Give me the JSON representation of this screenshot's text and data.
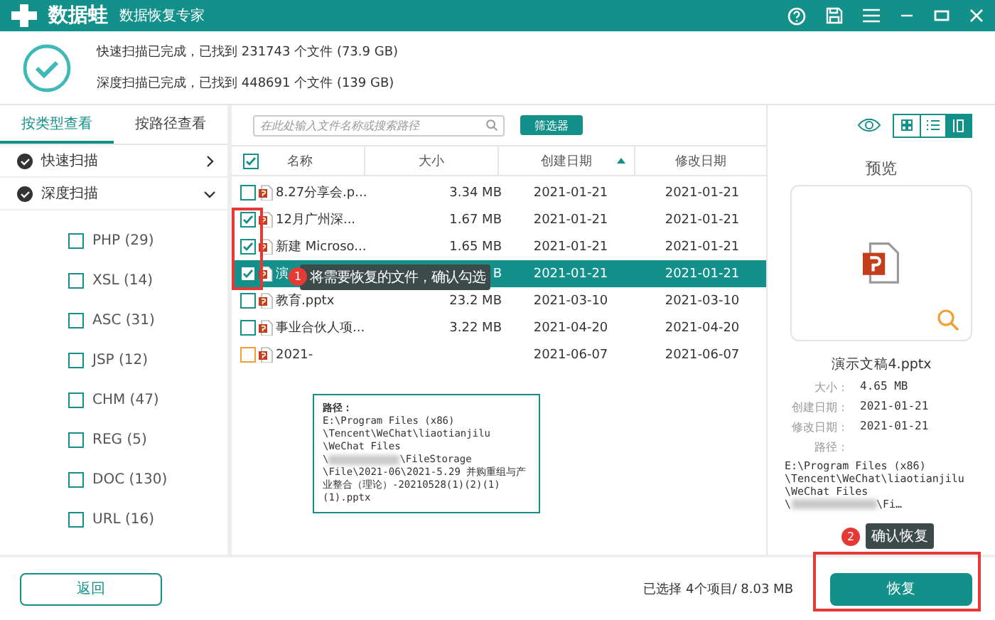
{
  "app": {
    "name": "数据蛙",
    "subtitle": "数据恢复专家"
  },
  "scan_summary": [
    "快速扫描已完成，已找到 231743 个文件 (73.9 GB)",
    "深度扫描已完成，已找到 448691 个文件 (139 GB)"
  ],
  "view_tabs": [
    {
      "label": "按类型查看",
      "selected": true
    },
    {
      "label": "按路径查看",
      "selected": false
    }
  ],
  "scans": [
    {
      "label": "快速扫描",
      "expanded": false
    },
    {
      "label": "深度扫描",
      "expanded": true
    }
  ],
  "file_types": [
    {
      "label": "PHP (29)",
      "checked": false
    },
    {
      "label": "XSL (14)",
      "checked": false
    },
    {
      "label": "ASC (31)",
      "checked": false
    },
    {
      "label": "JSP (12)",
      "checked": false
    },
    {
      "label": "CHM (47)",
      "checked": false
    },
    {
      "label": "REG (5)",
      "checked": false
    },
    {
      "label": "DOC (130)",
      "checked": false
    },
    {
      "label": "URL (16)",
      "checked": false
    }
  ],
  "search": {
    "placeholder": "在此处输入文件名称或搜索路径"
  },
  "filter_button": "筛选器",
  "view_modes": [
    {
      "kind": "grid",
      "selected": false
    },
    {
      "kind": "list",
      "selected": false
    },
    {
      "kind": "preview",
      "selected": true
    }
  ],
  "table": {
    "columns": [
      "名称",
      "大小",
      "创建日期",
      "修改日期"
    ],
    "header_checked": true,
    "rows": [
      {
        "name": "8.27分享会.p...",
        "size": "3.34 MB",
        "created": "2021-01-21",
        "modified": "2021-01-21",
        "checked": false,
        "selected": false,
        "hovered": false
      },
      {
        "name": "12月广州深...",
        "size": "1.67 MB",
        "created": "2021-01-21",
        "modified": "2021-01-21",
        "checked": true,
        "selected": false,
        "hovered": false
      },
      {
        "name": "新建 Microso...",
        "size": "1.65 MB",
        "created": "2021-01-21",
        "modified": "2021-01-21",
        "checked": true,
        "selected": false,
        "hovered": false
      },
      {
        "name": "演",
        "size": "B",
        "created": "2021-01-21",
        "modified": "2021-01-21",
        "checked": true,
        "selected": true,
        "hovered": false
      },
      {
        "name": "教育.pptx",
        "size": "23.2 MB",
        "created": "2021-03-10",
        "modified": "2021-03-10",
        "checked": false,
        "selected": false,
        "hovered": false
      },
      {
        "name": "事业合伙人项...",
        "size": "3.22 MB",
        "created": "2021-04-20",
        "modified": "2021-04-20",
        "checked": false,
        "selected": false,
        "hovered": false
      },
      {
        "name": "2021-",
        "size": "",
        "created": "2021-06-07",
        "modified": "2021-06-07",
        "checked": false,
        "selected": false,
        "hovered": true
      }
    ]
  },
  "hint_1": {
    "number": "1",
    "text": "将需要恢复的文件，确认勾选"
  },
  "path_tooltip": {
    "label": "路径：",
    "lines": [
      "E:\\Program Files (x86)",
      "\\Tencent\\WeChat\\liaotianjilu",
      "\\WeChat Files",
      {
        "before": "\\",
        "after": "\\FileStorage"
      },
      "\\File\\2021-06\\2021-5.29 并购重组与产业整合（理论）-20210528(1)(2)(1)(1).pptx"
    ]
  },
  "preview": {
    "title": "预览",
    "file_name": "演示文稿4.pptx",
    "info": [
      {
        "label": "大小：",
        "value": "4.65 MB"
      },
      {
        "label": "创建日期：",
        "value": "2021-01-21"
      },
      {
        "label": "修改日期：",
        "value": "2021-01-21"
      }
    ],
    "path_label": "路径：",
    "path_lines": [
      "E:\\Program Files (x86)",
      "\\Tencent\\WeChat\\liaotianjilu",
      "\\WeChat Files",
      {
        "before": "\\",
        "after": "\\Fi…"
      }
    ]
  },
  "hint_2": {
    "number": "2",
    "text": "确认恢复"
  },
  "footer": {
    "back_button": "返回",
    "selection": "已选择 4个项目/ 8.03 MB",
    "recover_button": "恢复"
  }
}
